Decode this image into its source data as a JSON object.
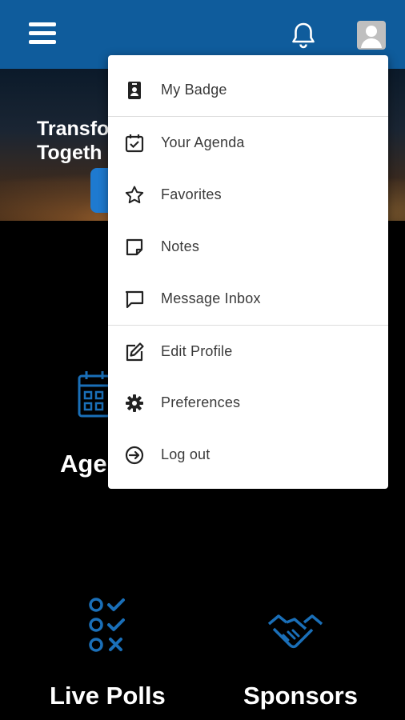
{
  "header": {
    "menu_icon": "hamburger-icon",
    "notification_icon": "bell-icon",
    "profile_icon": "user-avatar-icon",
    "background_color": "#0f5c9c"
  },
  "hero": {
    "title": "Transfo\nTogeth"
  },
  "tiles": [
    {
      "label": "Age",
      "icon": "calendar-icon"
    },
    {
      "label": "Live Polls",
      "icon": "poll-checklist-icon"
    },
    {
      "label": "Sponsors",
      "icon": "handshake-icon"
    }
  ],
  "dropdown": {
    "items": [
      {
        "label": "My Badge",
        "icon": "badge-icon"
      },
      {
        "label": "Your Agenda",
        "icon": "calendar-check-icon"
      },
      {
        "label": "Favorites",
        "icon": "star-icon"
      },
      {
        "label": "Notes",
        "icon": "note-icon"
      },
      {
        "label": "Message Inbox",
        "icon": "message-icon"
      },
      {
        "label": "Edit Profile",
        "icon": "edit-icon"
      },
      {
        "label": "Preferences",
        "icon": "gear-icon"
      },
      {
        "label": "Log out",
        "icon": "logout-icon"
      }
    ]
  },
  "colors": {
    "accent": "#1e7ad0",
    "icon_blue": "#1a6fb8"
  }
}
